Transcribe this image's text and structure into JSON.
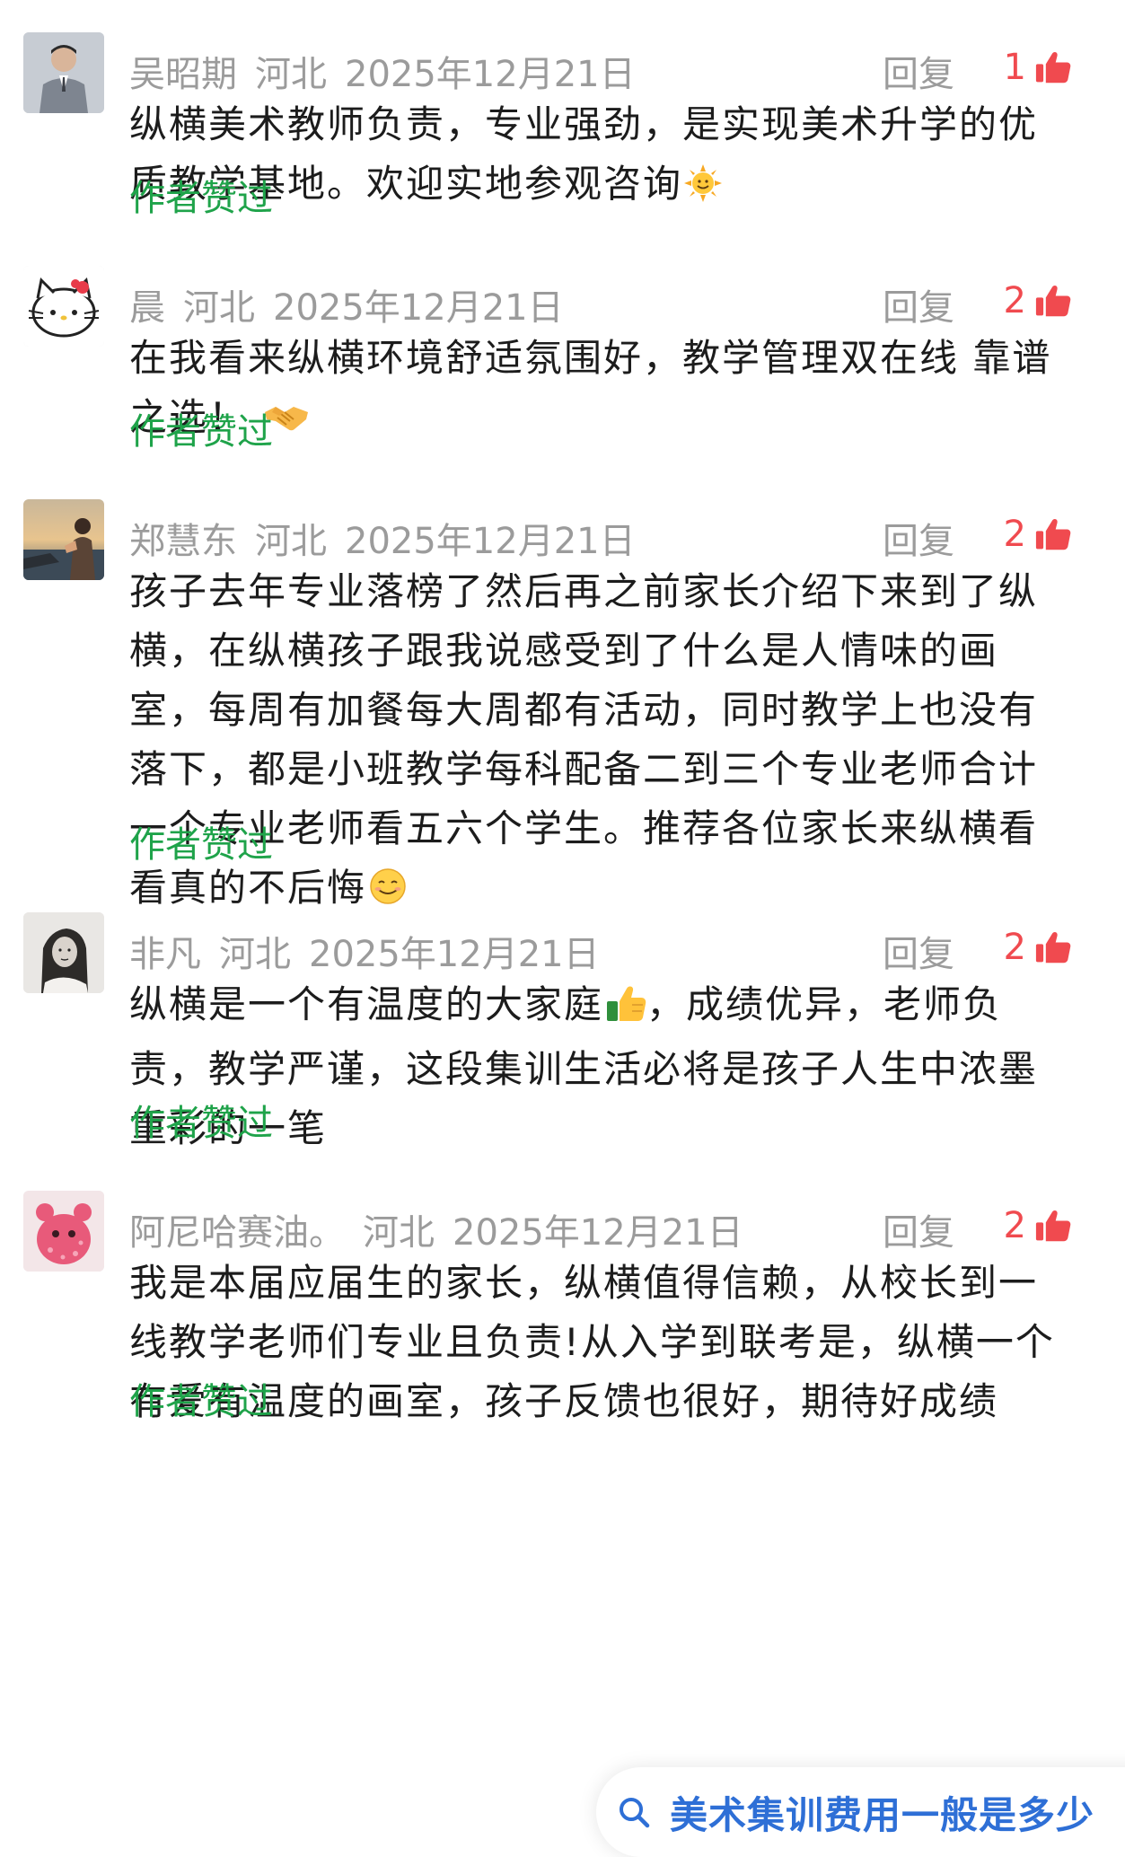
{
  "comments": [
    {
      "name": "吴昭期",
      "region": "河北",
      "date": "2025年12月21日",
      "reply_label": "回复",
      "likes": "1",
      "text": "纵横美术教师负责，专业强劲，是实现美术升学的优质教学基地。欢迎实地参观咨询",
      "emoji": "sun-face-emoji",
      "author_liked": "作者赞过",
      "avatar": "man-in-suit"
    },
    {
      "name": "晨",
      "region": "河北",
      "date": "2025年12月21日",
      "reply_label": "回复",
      "likes": "2",
      "text": "在我看来纵横环境舒适氛围好，教学管理双在线 靠谱之选！",
      "emoji": "handshake-emoji",
      "author_liked": "作者赞过",
      "avatar": "hello-kitty"
    },
    {
      "name": "郑慧东",
      "region": "河北",
      "date": "2025年12月21日",
      "reply_label": "回复",
      "likes": "2",
      "text": "孩子去年专业落榜了然后再之前家长介绍下来到了纵横，在纵横孩子跟我说感受到了什么是人情味的画室，每周有加餐每大周都有活动，同时教学上也没有落下，都是小班教学每科配备二到三个专业老师合计一个专业老师看五六个学生。推荐各位家长来纵横看看真的不后悔",
      "emoji": "smiling-face-emoji",
      "author_liked": "作者赞过",
      "avatar": "seaside-photo"
    },
    {
      "name": "非凡",
      "region": "河北",
      "date": "2025年12月21日",
      "reply_label": "回复",
      "likes": "2",
      "text_before_emoji": "纵横是一个有温度的大家庭",
      "text_after_emoji": "，成绩优异，老师负责，教学严谨，这段集训生活必将是孩子人生中浓墨重彩的一笔",
      "emoji": "thumbs-up-emoji",
      "author_liked": "作者赞过",
      "avatar": "bw-portrait"
    },
    {
      "name": "阿尼哈赛油。",
      "region": "河北",
      "date": "2025年12月21日",
      "reply_label": "回复",
      "likes": "2",
      "text": "我是本届应届生的家长，纵横值得信赖，从校长到一线教学老师们专业且负责!从入学到联考是，纵横一个有爱有温度的画室，孩子反馈也很好，期待好成绩",
      "author_liked": "作者赞过",
      "avatar": "pink-plush"
    }
  ],
  "search_suggestion": {
    "icon": "search-icon",
    "text": "美术集训费用一般是多少"
  },
  "colors": {
    "meta_gray": "#9b9b9b",
    "like_red": "#f04a4f",
    "author_liked_green": "#1fa34a",
    "search_blue": "#2e6fd6"
  }
}
